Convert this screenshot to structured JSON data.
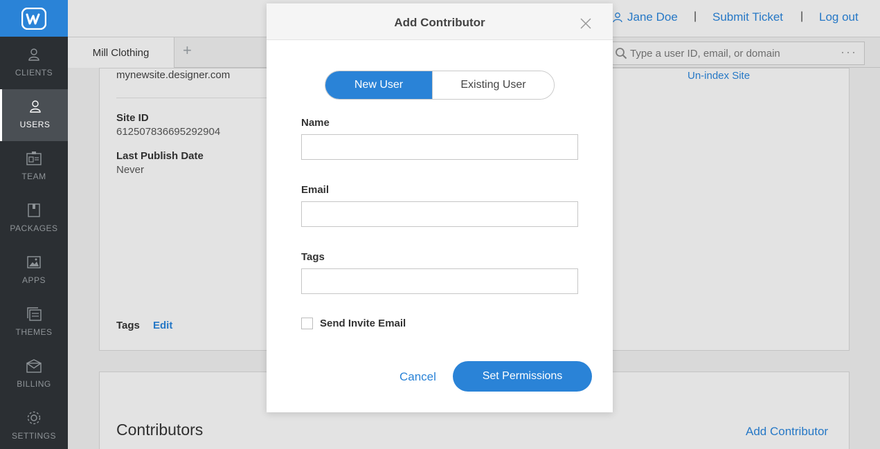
{
  "sidebar": {
    "items": [
      {
        "label": "CLIENTS",
        "icon": "person-icon"
      },
      {
        "label": "USERS",
        "icon": "person-icon",
        "active": true
      },
      {
        "label": "TEAM",
        "icon": "id-card-icon"
      },
      {
        "label": "PACKAGES",
        "icon": "box-icon"
      },
      {
        "label": "APPS",
        "icon": "image-icon"
      },
      {
        "label": "THEMES",
        "icon": "stack-icon"
      },
      {
        "label": "BILLING",
        "icon": "envelope-icon"
      },
      {
        "label": "SETTINGS",
        "icon": "gear-icon"
      }
    ]
  },
  "header": {
    "user_name": "Jane Doe",
    "submit_ticket": "Submit Ticket",
    "log_out": "Log out",
    "separator": "|"
  },
  "tabs": {
    "site_tab": "Mill Clothing",
    "add_tab": "+"
  },
  "search": {
    "placeholder": "Type a user ID, email, or domain",
    "more": "···"
  },
  "site": {
    "url": "mynewsite.designer.com",
    "site_id_label": "Site ID",
    "site_id_value": "612507836695292904",
    "last_publish_label": "Last Publish Date",
    "last_publish_value": "Never",
    "tags_label": "Tags",
    "tags_edit": "Edit",
    "unindex_link": "Un-index Site"
  },
  "contributors": {
    "title": "Contributors",
    "add_link": "Add Contributor"
  },
  "modal": {
    "title": "Add Contributor",
    "toggle_new": "New User",
    "toggle_existing": "Existing User",
    "name_label": "Name",
    "email_label": "Email",
    "tags_label": "Tags",
    "send_invite_label": "Send Invite Email",
    "cancel": "Cancel",
    "submit": "Set Permissions"
  },
  "colors": {
    "accent": "#2a83d7",
    "sidebar_bg": "#2b2f33",
    "sidebar_active": "#4a4f54"
  }
}
